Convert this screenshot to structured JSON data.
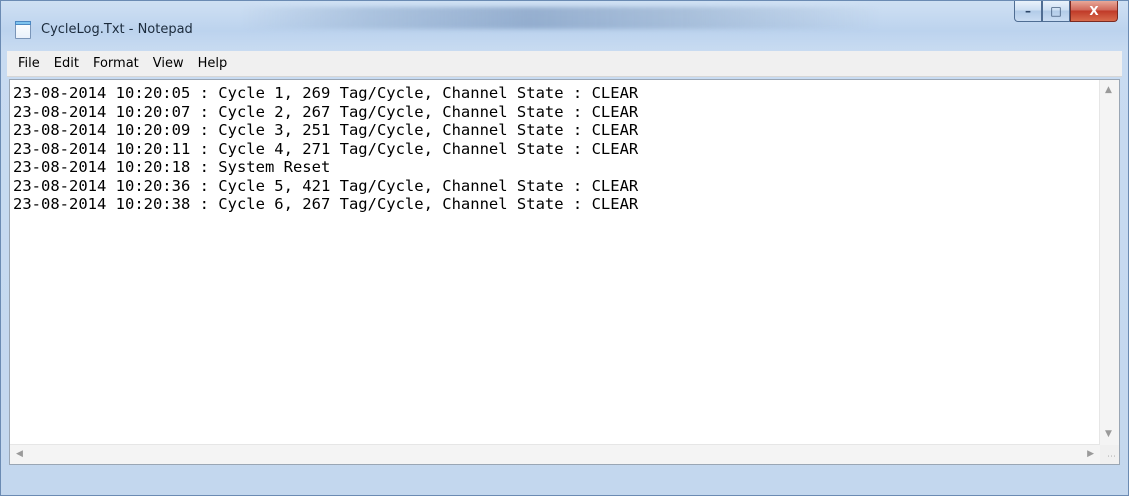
{
  "window": {
    "title": "CycleLog.Txt - Notepad",
    "icons": {
      "app": "notepad-document-icon",
      "minimize": "minimize-icon",
      "maximize": "maximize-icon",
      "close": "close-icon"
    },
    "caption_glyphs": {
      "minimize": "–",
      "maximize": "□",
      "close": "X"
    },
    "colors": {
      "close_button": "#c9402c",
      "frame": "#bcd3ee"
    }
  },
  "menubar": {
    "items": [
      {
        "label": "File"
      },
      {
        "label": "Edit"
      },
      {
        "label": "Format"
      },
      {
        "label": "View"
      },
      {
        "label": "Help"
      }
    ]
  },
  "document": {
    "lines": [
      "23-08-2014 10:20:05 : Cycle 1, 269 Tag/Cycle, Channel State : CLEAR",
      "23-08-2014 10:20:07 : Cycle 2, 267 Tag/Cycle, Channel State : CLEAR",
      "23-08-2014 10:20:09 : Cycle 3, 251 Tag/Cycle, Channel State : CLEAR",
      "23-08-2014 10:20:11 : Cycle 4, 271 Tag/Cycle, Channel State : CLEAR",
      "23-08-2014 10:20:18 : System Reset",
      "23-08-2014 10:20:36 : Cycle 5, 421 Tag/Cycle, Channel State : CLEAR",
      "23-08-2014 10:20:38 : Cycle 6, 267 Tag/Cycle, Channel State : CLEAR"
    ]
  },
  "scrollbars": {
    "icons": {
      "up": "scroll-up-arrow-icon",
      "down": "scroll-down-arrow-icon",
      "left": "scroll-left-arrow-icon",
      "right": "scroll-right-arrow-icon",
      "grip": "size-grip-icon"
    }
  }
}
